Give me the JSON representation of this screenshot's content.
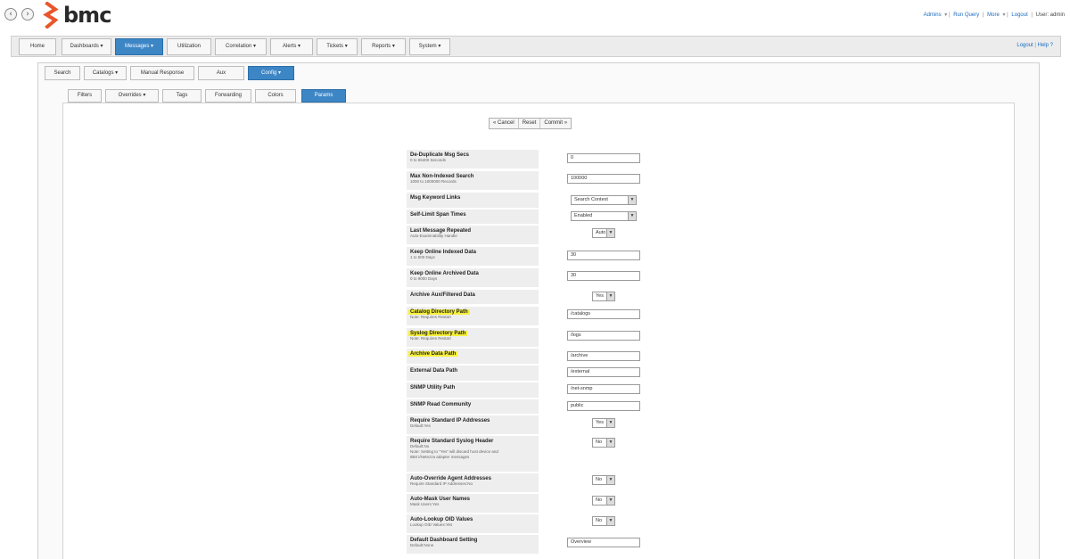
{
  "header": {
    "back_glyph": "‹",
    "forward_glyph": "›",
    "logo_text": "bmc",
    "brand_color": "#e8562a",
    "user_links": [
      "Admins",
      "Run Query",
      "More",
      "Logout"
    ],
    "user_label": "User: admin"
  },
  "main_nav": {
    "tabs": [
      "Home",
      "Dashboards ▾",
      "Messages ▾",
      "Utilization",
      "Correlation ▾",
      "Alerts ▾",
      "Tickets ▾",
      "Reports ▾",
      "System ▾"
    ],
    "active": "Messages ▾",
    "right_links": [
      "Logout",
      "Help"
    ]
  },
  "sub_nav": {
    "tabs": [
      "Search",
      "Catalogs ▾",
      "Manual Response",
      "Aux",
      "Config ▾"
    ],
    "active": "Config ▾"
  },
  "config_nav": {
    "tabs": [
      "Filters",
      "Overrides ▾",
      "Tags",
      "Forwarding",
      "Colors",
      "Params"
    ],
    "active": "Params"
  },
  "actions": [
    "« Cancel",
    "Reset",
    "Commit »"
  ],
  "settings": [
    {
      "label": "De-Duplicate Msg Secs",
      "sub": [
        "0 to 86400 Seconds"
      ],
      "control": "text",
      "value": "0"
    },
    {
      "label": "Max Non-Indexed Search",
      "sub": [
        "1000 to 1000000 Records"
      ],
      "control": "text",
      "value": "100000"
    },
    {
      "label": "Msg Keyword Links",
      "sub": [],
      "control": "select",
      "value": "Search Context"
    },
    {
      "label": "Self-Limit Span Times",
      "sub": [],
      "control": "select",
      "value": "Enabled"
    },
    {
      "label": "Last Message Repeated",
      "sub": [
        "Auto-Examinability Handle"
      ],
      "control": "select-small",
      "value": "Auto"
    },
    {
      "label": "Keep Online Indexed Data",
      "sub": [
        "1 to 500 Days"
      ],
      "control": "text",
      "value": "30"
    },
    {
      "label": "Keep Online Archived Data",
      "sub": [
        "0 to 9000 Days"
      ],
      "control": "text",
      "value": "30"
    },
    {
      "label": "Archive Aux/Filtered Data",
      "sub": [],
      "control": "select-small",
      "value": "Yes"
    },
    {
      "label": "Catalog Directory Path",
      "highlight": true,
      "sub": [
        "Note: Requires Restart"
      ],
      "control": "text",
      "value": "/catalogs"
    },
    {
      "label": "Syslog Directory Path",
      "highlight": true,
      "sub": [
        "Note: Requires Restart"
      ],
      "control": "text",
      "value": "/logs"
    },
    {
      "label": "Archive Data Path",
      "highlight": true,
      "sub": [],
      "control": "text",
      "value": "/archive"
    },
    {
      "label": "External Data Path",
      "sub": [],
      "control": "text",
      "value": "/external"
    },
    {
      "label": "SNMP Utility Path",
      "sub": [],
      "control": "text",
      "value": "/net-snmp"
    },
    {
      "label": "SNMP Read Community",
      "sub": [],
      "control": "text",
      "value": "public"
    },
    {
      "label": "Require Standard IP Addresses",
      "sub": [
        "Default:Yes"
      ],
      "control": "select-small",
      "value": "Yes"
    },
    {
      "label": "Require Standard Syslog Header",
      "sub": [
        "Default:No",
        "Note: Setting to \"Yes\" will discard host device and",
        "IBM i/Netezza adapter messages"
      ],
      "control": "select-small",
      "value": "No"
    },
    {
      "label": "Auto-Override Agent Addresses",
      "sub": [
        "Require Standard IP Addresses:No"
      ],
      "control": "select-small",
      "value": "No"
    },
    {
      "label": "Auto-Mask User Names",
      "sub": [
        "Mask Users:Yes"
      ],
      "control": "select-small",
      "value": "No"
    },
    {
      "label": "Auto-Lookup OID Values",
      "sub": [
        "Lookup OID Values:Yes"
      ],
      "control": "select-small",
      "value": "No"
    },
    {
      "label": "Default Dashboard Setting",
      "sub": [
        "Default:None"
      ],
      "control": "text",
      "value": "Overview"
    }
  ]
}
